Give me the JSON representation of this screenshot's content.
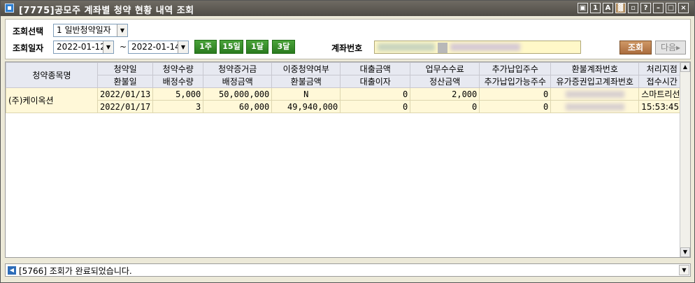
{
  "window": {
    "title": "[7775]공모주 계좌별 청약 현황 내역 조회",
    "title_buttons": [
      "▣",
      "1",
      "A",
      "▓",
      "▫",
      "?",
      "–",
      "□",
      "×"
    ]
  },
  "search": {
    "type_label": "조회선택",
    "type_value": "1 일반청약일자",
    "date_label": "조회일자",
    "date_from": "2022-01-12",
    "date_sep": "~",
    "date_to": "2022-01-14",
    "period_buttons": [
      "1주",
      "15일",
      "1달",
      "3달"
    ],
    "account_label": "계좌번호",
    "query_button": "조회",
    "next_button": "다음▸"
  },
  "grid": {
    "header_row1": [
      "청약종목명",
      "청약일",
      "청약수량",
      "청약증거금",
      "이중청약여부",
      "대출금액",
      "업무수수료",
      "추가납입주수",
      "환불계좌번호",
      "처리지점"
    ],
    "header_row2": [
      "환불일",
      "배정수량",
      "배정금액",
      "환불금액",
      "대출이자",
      "정산금액",
      "추가납입가능주수",
      "유가증권입고계좌번호",
      "접수시간"
    ],
    "stock_name": "(주)케이옥션",
    "row1": [
      "2022/01/13",
      "5,000",
      "50,000,000",
      "N",
      "0",
      "2,000",
      "0",
      "",
      "스마트리선"
    ],
    "row2": [
      "2022/01/17",
      "3",
      "60,000",
      "49,940,000",
      "0",
      "0",
      "0",
      "",
      "15:53:45"
    ]
  },
  "status": {
    "message": "[5766] 조회가 완료되었습니다."
  }
}
